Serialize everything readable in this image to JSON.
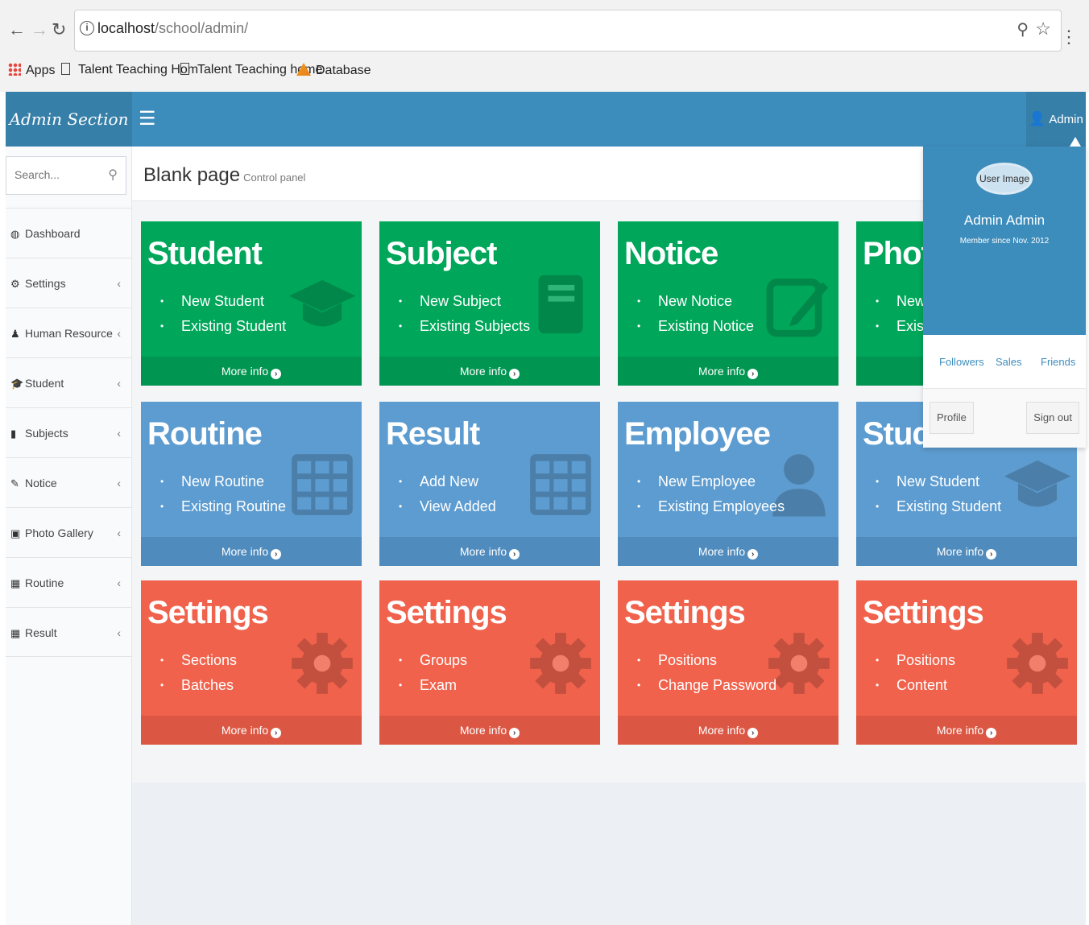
{
  "browser": {
    "url_host": "localhost",
    "url_path": "/school/admin/",
    "bookmarks": [
      "Apps",
      "Talent Teaching Hom",
      "Talent Teaching home",
      "Database"
    ]
  },
  "header": {
    "logo": "Admin Section",
    "hamburger": "☰",
    "user_label": "Admin"
  },
  "sidebar": {
    "search_placeholder": "Search...",
    "items": [
      {
        "label": "Dashboard",
        "icon": "dashboard-icon"
      },
      {
        "label": "Settings",
        "icon": "gear-icon"
      },
      {
        "label": "Human Resource",
        "icon": "user-icon"
      },
      {
        "label": "Student",
        "icon": "graduation-cap-icon"
      },
      {
        "label": "Subjects",
        "icon": "book-icon"
      },
      {
        "label": "Notice",
        "icon": "edit-icon"
      },
      {
        "label": "Photo Gallery",
        "icon": "picture-icon"
      },
      {
        "label": "Routine",
        "icon": "table-icon"
      },
      {
        "label": "Result",
        "icon": "table-icon"
      }
    ]
  },
  "content": {
    "title": "Blank page",
    "subtitle": "Control panel"
  },
  "tiles": [
    {
      "title": "Student",
      "items": [
        "New Student",
        "Existing Student"
      ],
      "more": "More info",
      "color": "#00a65a",
      "icon": "graduation-cap-icon"
    },
    {
      "title": "Subject",
      "items": [
        "New Subject",
        "Existing Subjects"
      ],
      "more": "More info",
      "color": "#00a65a",
      "icon": "book-icon"
    },
    {
      "title": "Notice",
      "items": [
        "New Notice",
        "Existing Notice"
      ],
      "more": "More info",
      "color": "#00a65a",
      "icon": "edit-icon"
    },
    {
      "title": "Photo",
      "items": [
        "New G",
        "Existir"
      ],
      "more": "More info",
      "color": "#00a65a",
      "icon": "picture-icon"
    },
    {
      "title": "Routine",
      "items": [
        "New Routine",
        "Existing Routine"
      ],
      "more": "More info",
      "color": "#5d9cd0",
      "icon": "table-icon"
    },
    {
      "title": "Result",
      "items": [
        "Add New",
        "View Added"
      ],
      "more": "More info",
      "color": "#5d9cd0",
      "icon": "table-icon"
    },
    {
      "title": "Employee",
      "items": [
        "New Employee",
        "Existing Employees"
      ],
      "more": "More info",
      "color": "#5d9cd0",
      "icon": "user-icon"
    },
    {
      "title": "Stude",
      "items": [
        "New Student",
        "Existing Student"
      ],
      "more": "More info",
      "color": "#5d9cd0",
      "icon": "graduation-cap-icon"
    },
    {
      "title": "Settings",
      "items": [
        "Sections",
        "Batches"
      ],
      "more": "More info",
      "color": "#f0624c",
      "icon": "gear-icon"
    },
    {
      "title": "Settings",
      "items": [
        "Groups",
        "Exam"
      ],
      "more": "More info",
      "color": "#f0624c",
      "icon": "gear-icon"
    },
    {
      "title": "Settings",
      "items": [
        "Positions",
        "Change Password"
      ],
      "more": "More info",
      "color": "#f0624c",
      "icon": "gear-icon"
    },
    {
      "title": "Settings",
      "items": [
        "Positions",
        "Content"
      ],
      "more": "More info",
      "color": "#f0624c",
      "icon": "gear-icon"
    }
  ],
  "dropdown": {
    "avatar_alt": "User Image",
    "name": "Admin Admin",
    "since": "Member since Nov. 2012",
    "links": [
      "Followers",
      "Sales",
      "Friends"
    ],
    "profile": "Profile",
    "signout": "Sign out"
  }
}
